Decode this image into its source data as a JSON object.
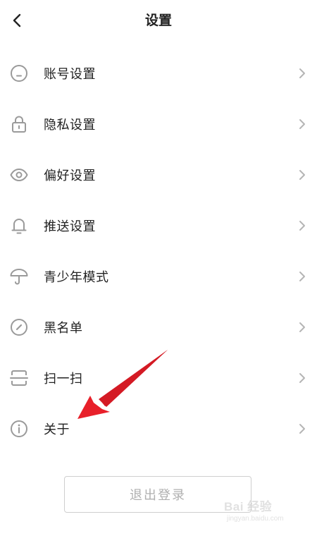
{
  "header": {
    "title": "设置",
    "back_icon": "chevron-left-icon"
  },
  "menu": {
    "items": [
      {
        "label": "账号设置",
        "icon": "account-icon"
      },
      {
        "label": "隐私设置",
        "icon": "lock-icon"
      },
      {
        "label": "偏好设置",
        "icon": "eye-icon"
      },
      {
        "label": "推送设置",
        "icon": "bell-icon"
      },
      {
        "label": "青少年模式",
        "icon": "umbrella-icon"
      },
      {
        "label": "黑名单",
        "icon": "compass-icon"
      },
      {
        "label": "扫一扫",
        "icon": "scan-icon"
      },
      {
        "label": "关于",
        "icon": "info-icon"
      }
    ],
    "chevron_icon": "chevron-right-icon"
  },
  "logout": {
    "label": "退出登录"
  },
  "annotation": {
    "color": "#e8202a"
  },
  "watermark": {
    "text": "Bai 经验",
    "sub": "jingyan.baidu.com"
  },
  "colors": {
    "icon_gray": "#9a9a9a",
    "chevron_gray": "#b5b5b5",
    "text": "#222222",
    "logout_text": "#b0b0b0",
    "logout_border": "#cfcfcf"
  }
}
